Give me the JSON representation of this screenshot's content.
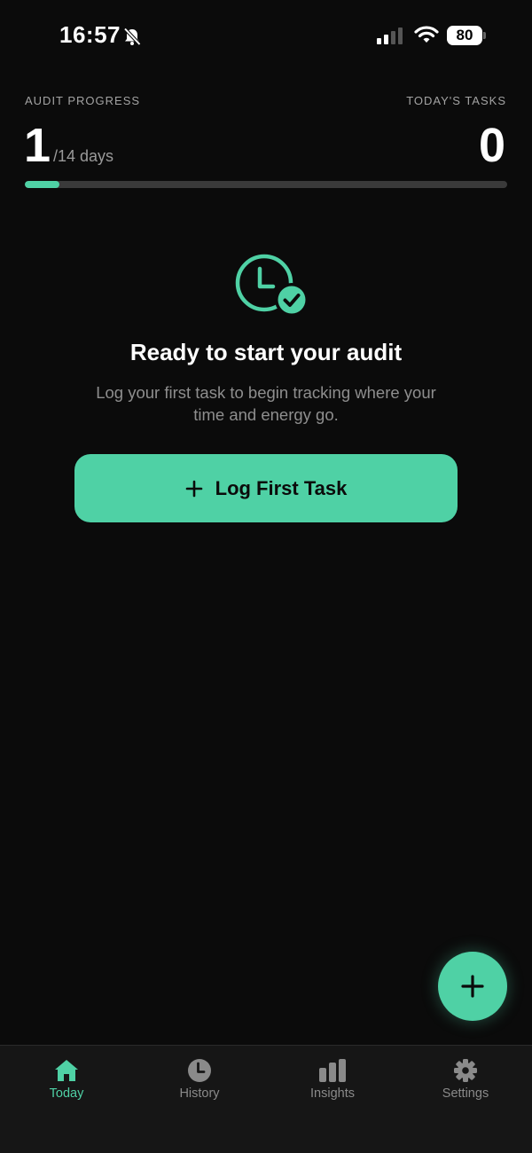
{
  "status_bar": {
    "time": "16:57",
    "battery": "80"
  },
  "header": {
    "progress_label": "AUDIT PROGRESS",
    "current_day": "1",
    "total_days": "/14 days",
    "progress_fraction": 0.0714,
    "tasks_label": "TODAY'S TASKS",
    "tasks_count": "0"
  },
  "empty_state": {
    "icon": "clock-check-icon",
    "title": "Ready to start your audit",
    "description": "Log your first task to begin tracking where your time and energy go.",
    "button_label": "Log First Task"
  },
  "tabs": [
    {
      "label": "Today",
      "icon": "home-icon",
      "active": true
    },
    {
      "label": "History",
      "icon": "clock-icon",
      "active": false
    },
    {
      "label": "Insights",
      "icon": "bar-chart-icon",
      "active": false
    },
    {
      "label": "Settings",
      "icon": "gear-icon",
      "active": false
    }
  ],
  "colors": {
    "accent": "#4fd1a5",
    "background": "#0b0b0b",
    "tab_bar": "#161616",
    "muted_text": "#8e8e8e"
  }
}
